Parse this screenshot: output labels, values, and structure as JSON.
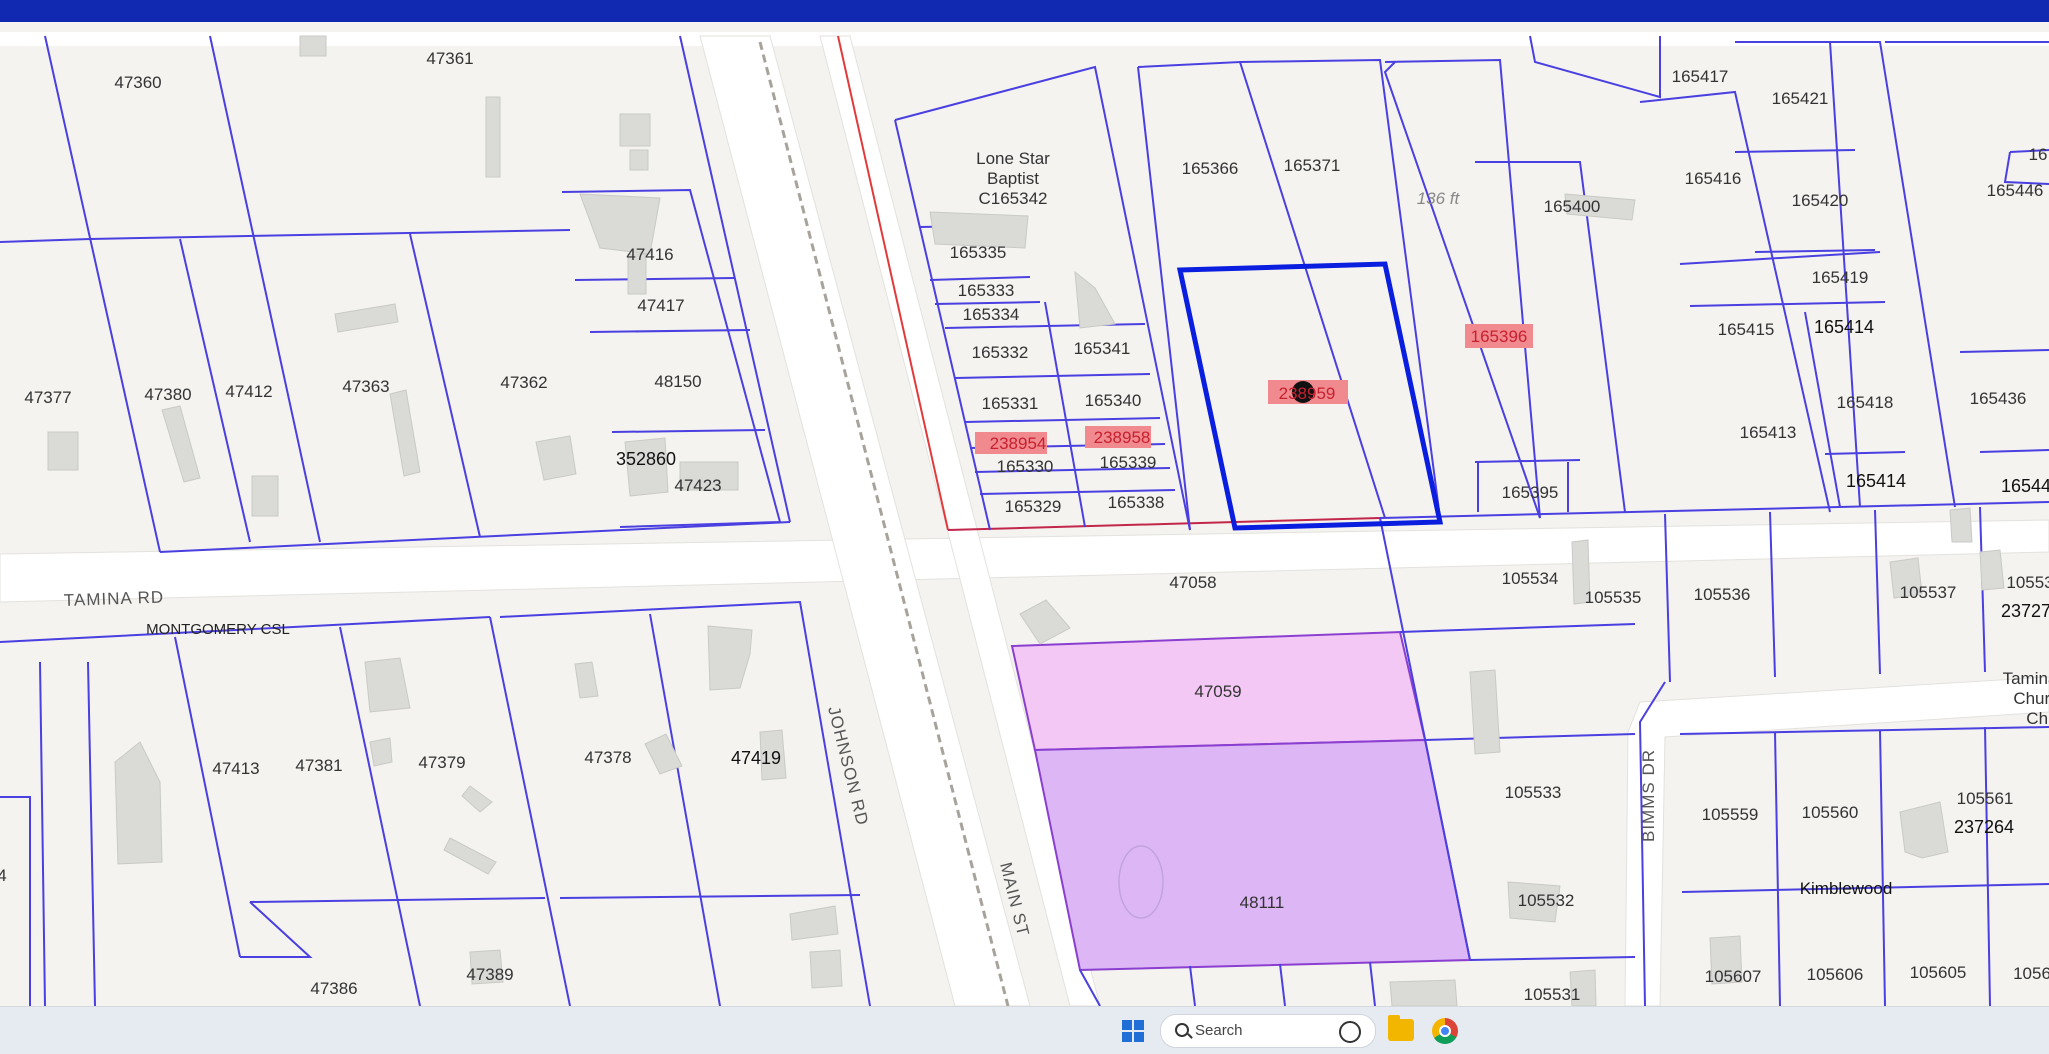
{
  "map": {
    "parcels": [
      {
        "id": "p47360",
        "label": "47360"
      },
      {
        "id": "p47361",
        "label": "47361"
      },
      {
        "id": "p47416",
        "label": "47416"
      },
      {
        "id": "p47417",
        "label": "47417"
      },
      {
        "id": "p48150",
        "label": "48150"
      },
      {
        "id": "p47377",
        "label": "47377"
      },
      {
        "id": "p47380",
        "label": "47380"
      },
      {
        "id": "p47412",
        "label": "47412"
      },
      {
        "id": "p47363",
        "label": "47363"
      },
      {
        "id": "p47362",
        "label": "47362"
      },
      {
        "id": "p352860",
        "label": "352860"
      },
      {
        "id": "p47423",
        "label": "47423"
      },
      {
        "id": "p165366",
        "label": "165366"
      },
      {
        "id": "p165371",
        "label": "165371"
      },
      {
        "id": "p165417",
        "label": "165417"
      },
      {
        "id": "p165421",
        "label": "165421"
      },
      {
        "id": "p165416",
        "label": "165416"
      },
      {
        "id": "p165420",
        "label": "165420"
      },
      {
        "id": "p165400",
        "label": "165400"
      },
      {
        "id": "p165419",
        "label": "165419"
      },
      {
        "id": "p165415",
        "label": "165415"
      },
      {
        "id": "p165414a",
        "label": "165414"
      },
      {
        "id": "p165418",
        "label": "165418"
      },
      {
        "id": "p165413",
        "label": "165413"
      },
      {
        "id": "p165414b",
        "label": "165414"
      },
      {
        "id": "p165436",
        "label": "165436"
      },
      {
        "id": "p165395",
        "label": "165395"
      },
      {
        "id": "p165335",
        "label": "165335"
      },
      {
        "id": "p165333",
        "label": "165333"
      },
      {
        "id": "p165334",
        "label": "165334"
      },
      {
        "id": "p165332",
        "label": "165332"
      },
      {
        "id": "p165341",
        "label": "165341"
      },
      {
        "id": "p165331",
        "label": "165331"
      },
      {
        "id": "p165340",
        "label": "165340"
      },
      {
        "id": "p165330",
        "label": "165330"
      },
      {
        "id": "p165339",
        "label": "165339"
      },
      {
        "id": "p165329",
        "label": "165329"
      },
      {
        "id": "p165338",
        "label": "165338"
      },
      {
        "id": "p47058",
        "label": "47058"
      },
      {
        "id": "p47059",
        "label": "47059"
      },
      {
        "id": "p48111",
        "label": "48111"
      },
      {
        "id": "p105534",
        "label": "105534"
      },
      {
        "id": "p105535",
        "label": "105535"
      },
      {
        "id": "p105536",
        "label": "105536"
      },
      {
        "id": "p105537",
        "label": "105537"
      },
      {
        "id": "p105533",
        "label": "105533"
      },
      {
        "id": "p105532",
        "label": "105532"
      },
      {
        "id": "p105531",
        "label": "105531"
      },
      {
        "id": "p105559",
        "label": "105559"
      },
      {
        "id": "p105560",
        "label": "105560"
      },
      {
        "id": "p105561",
        "label": "105561"
      },
      {
        "id": "p237264",
        "label": "237264"
      },
      {
        "id": "p105607",
        "label": "105607"
      },
      {
        "id": "p105606",
        "label": "105606"
      },
      {
        "id": "p105605",
        "label": "105605"
      },
      {
        "id": "p47413",
        "label": "47413"
      },
      {
        "id": "p47381",
        "label": "47381"
      },
      {
        "id": "p47379",
        "label": "47379"
      },
      {
        "id": "p47378",
        "label": "47378"
      },
      {
        "id": "p47419",
        "label": "47419"
      },
      {
        "id": "p47386",
        "label": "47386"
      },
      {
        "id": "p47389",
        "label": "47389"
      }
    ],
    "highlighted": [
      {
        "id": "h238959",
        "label": "238959"
      },
      {
        "id": "h165396",
        "label": "165396"
      },
      {
        "id": "h238954",
        "label": "238954"
      },
      {
        "id": "h238958",
        "label": "238958"
      }
    ],
    "cut_labels": {
      "right_top": "16",
      "right_1": "165446",
      "right_2": "16544",
      "right_3": "10553",
      "right_4": "23727",
      "right_5": "1056",
      "left_edge": "4"
    },
    "place_labels": {
      "church_line1": "Lone Star",
      "church_line2": "Baptist",
      "church_line3": "C165342",
      "tamina_church_1": "Tamina",
      "tamina_church_2": "Churc",
      "tamina_church_3": "Chr",
      "subdivision": "Kimblewood",
      "csl": "MONTGOMERY CSL",
      "measure": "136 ft"
    },
    "roads": {
      "tamina": "TAMINA RD",
      "johnson": "JOHNSON RD",
      "main": "MAIN ST",
      "bimms": "BIMMS DR"
    },
    "colors": {
      "parcel_line": "#4a3fe0",
      "selected_outline": "#0a1ee0",
      "highlight_fill": "#f08a8f",
      "pink_parcel": "#f4c8f4",
      "purple_parcel": "#ddb6f5",
      "header": "#1128b0"
    }
  },
  "taskbar": {
    "search_placeholder": "Search",
    "icons": [
      "windows-start-icon",
      "search-icon",
      "file-explorer-icon",
      "chrome-icon"
    ]
  }
}
